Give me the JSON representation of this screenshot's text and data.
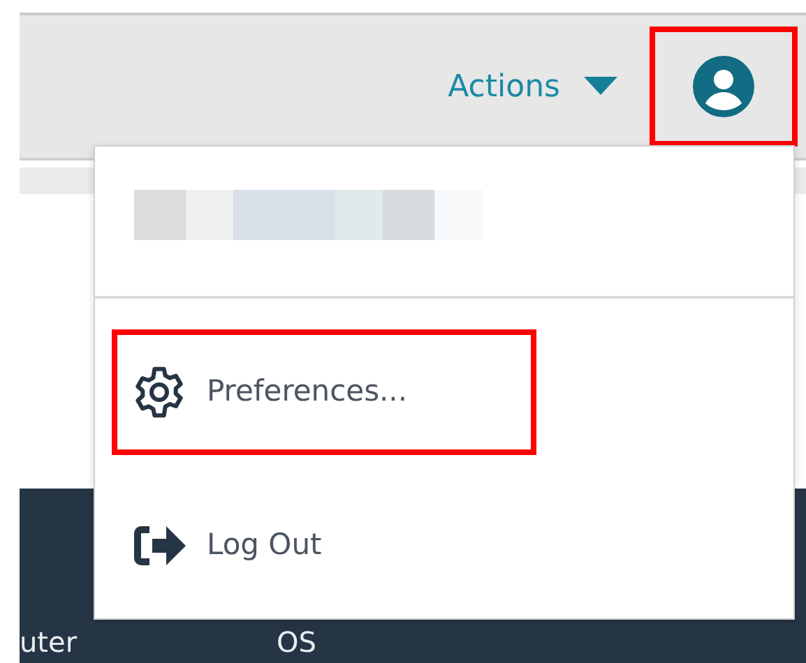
{
  "toolbar": {
    "actions_label": "Actions",
    "account_button": {
      "highlighted": true
    }
  },
  "user_menu": {
    "items": [
      {
        "kind": "gear",
        "label": "Preferences...",
        "highlighted": true
      },
      {
        "kind": "logout",
        "label": "Log Out",
        "highlighted": false
      }
    ]
  },
  "table": {
    "columns": [
      "uter",
      "OS"
    ]
  }
}
